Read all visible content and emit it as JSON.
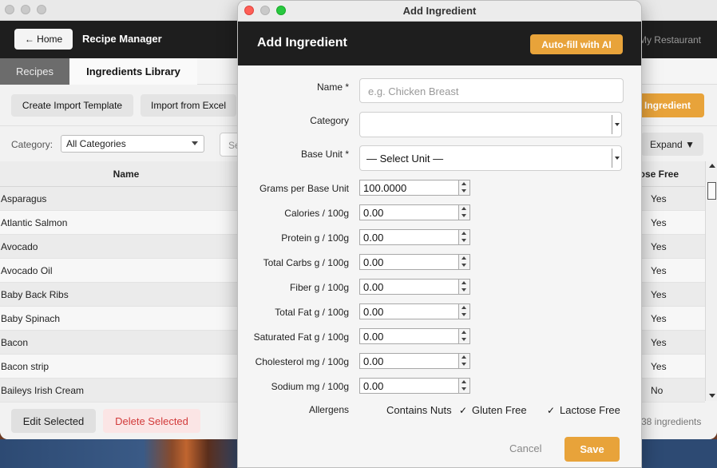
{
  "main": {
    "home_label": "← Home",
    "app_title": "Recipe Manager",
    "restaurant": "My Restaurant",
    "tabs": [
      {
        "label": "Recipes"
      },
      {
        "label": "Ingredients Library"
      }
    ],
    "toolbar": {
      "create_template": "Create Import Template",
      "import_excel": "Import from Excel",
      "add_ingredient": "Ingredient"
    },
    "filter": {
      "category_label": "Category:",
      "category_value": "All Categories",
      "search_partial": "Se",
      "expand_label": "Expand ▼"
    },
    "table": {
      "columns": [
        "Name",
        "ctose Free"
      ],
      "rows": [
        {
          "name": "Asparagus",
          "lactose_free": "Yes"
        },
        {
          "name": "Atlantic Salmon",
          "lactose_free": "Yes"
        },
        {
          "name": "Avocado",
          "lactose_free": "Yes"
        },
        {
          "name": "Avocado Oil",
          "lactose_free": "Yes"
        },
        {
          "name": "Baby Back Ribs",
          "lactose_free": "Yes"
        },
        {
          "name": "Baby Spinach",
          "lactose_free": "Yes"
        },
        {
          "name": "Bacon",
          "lactose_free": "Yes"
        },
        {
          "name": "Bacon strip",
          "lactose_free": "Yes"
        },
        {
          "name": "Baileys Irish Cream",
          "lactose_free": "No"
        }
      ]
    },
    "footer": {
      "edit_label": "Edit Selected",
      "delete_label": "Delete Selected",
      "count": "38 ingredients"
    }
  },
  "dialog": {
    "window_title": "Add Ingredient",
    "header": "Add Ingredient",
    "autofill_label": "Auto-fill with AI",
    "name_label": "Name *",
    "name_placeholder": "e.g. Chicken Breast",
    "category_label": "Category",
    "category_value": "",
    "base_unit_label": "Base Unit *",
    "base_unit_value": "— Select Unit —",
    "fields": [
      {
        "label": "Grams per Base Unit",
        "value": "100.0000"
      },
      {
        "label": "Calories / 100g",
        "value": "0.00"
      },
      {
        "label": "Protein g / 100g",
        "value": "0.00"
      },
      {
        "label": "Total Carbs g / 100g",
        "value": "0.00"
      },
      {
        "label": "Fiber g / 100g",
        "value": "0.00"
      },
      {
        "label": "Total Fat g / 100g",
        "value": "0.00"
      },
      {
        "label": "Saturated Fat g / 100g",
        "value": "0.00"
      },
      {
        "label": "Cholesterol mg / 100g",
        "value": "0.00"
      },
      {
        "label": "Sodium mg / 100g",
        "value": "0.00"
      }
    ],
    "allergens_label": "Allergens",
    "allergens": [
      {
        "label": "Contains Nuts",
        "checked": false,
        "mark": ""
      },
      {
        "label": "Gluten Free",
        "checked": true,
        "mark": "✓"
      },
      {
        "label": "Lactose Free",
        "checked": true,
        "mark": "✓"
      }
    ],
    "cancel_label": "Cancel",
    "save_label": "Save"
  },
  "colors": {
    "accent": "#e8a33a",
    "header_dark": "#1e1e1e",
    "danger": "#d23b3b"
  }
}
